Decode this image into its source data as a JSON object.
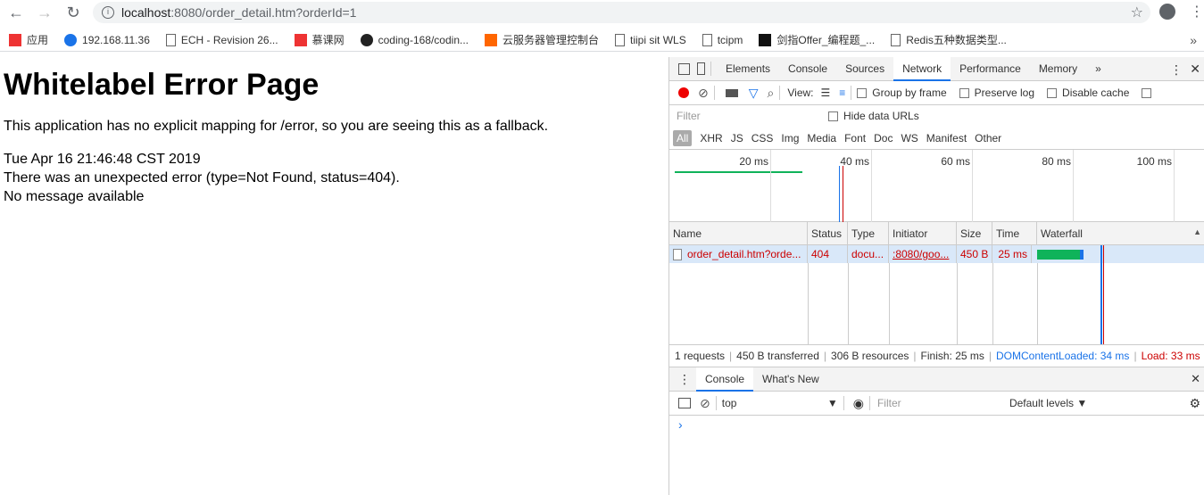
{
  "browser": {
    "url_host": "localhost",
    "url_rest": ":8080/order_detail.htm?orderId=1",
    "bookmarks": [
      {
        "label": "应用",
        "icon": "apps-grid-icon"
      },
      {
        "label": "192.168.11.36",
        "icon": "globe-icon"
      },
      {
        "label": "ECH - Revision 26...",
        "icon": "page-icon"
      },
      {
        "label": "慕课网",
        "icon": "flame-icon"
      },
      {
        "label": "coding-168/codin...",
        "icon": "github-icon"
      },
      {
        "label": "云服务器管理控制台",
        "icon": "aliyun-icon"
      },
      {
        "label": "tiipi sit WLS",
        "icon": "page-icon"
      },
      {
        "label": "tcipm",
        "icon": "page-icon"
      },
      {
        "label": "剑指Offer_编程题_...",
        "icon": "nowcoder-icon"
      },
      {
        "label": "Redis五种数据类型...",
        "icon": "bookmark-icon"
      }
    ],
    "more": "»"
  },
  "page": {
    "title": "Whitelabel Error Page",
    "line1": "This application has no explicit mapping for /error, so you are seeing this as a fallback.",
    "line2": "Tue Apr 16 21:46:48 CST 2019",
    "line3": "There was an unexpected error (type=Not Found, status=404).",
    "line4": "No message available"
  },
  "devtools": {
    "tabs": [
      "Elements",
      "Console",
      "Sources",
      "Network",
      "Performance",
      "Memory"
    ],
    "active_tab": "Network",
    "more": "»",
    "view_label": "View:",
    "group_by_frame": "Group by frame",
    "preserve_log": "Preserve log",
    "disable_cache": "Disable cache",
    "filter_placeholder": "Filter",
    "hide_data_urls": "Hide data URLs",
    "types": [
      "All",
      "XHR",
      "JS",
      "CSS",
      "Img",
      "Media",
      "Font",
      "Doc",
      "WS",
      "Manifest",
      "Other"
    ],
    "ticks": [
      "20 ms",
      "40 ms",
      "60 ms",
      "80 ms",
      "100 ms"
    ],
    "columns": [
      "Name",
      "Status",
      "Type",
      "Initiator",
      "Size",
      "Time",
      "Waterfall"
    ],
    "row": {
      "name": "order_detail.htm?orde...",
      "status": "404",
      "type": "docu...",
      "initiator": ":8080/goo...",
      "size": "450 B",
      "time": "25 ms"
    },
    "summary": {
      "requests": "1 requests",
      "transferred": "450 B transferred",
      "resources": "306 B resources",
      "finish": "Finish: 25 ms",
      "dcl": "DOMContentLoaded: 34 ms",
      "load": "Load: 33 ms"
    },
    "drawer_tabs": [
      "Console",
      "What's New"
    ],
    "context": "top",
    "console_filter": "Filter",
    "levels": "Default levels ▼",
    "prompt": "›",
    "colors": {
      "accent": "#1a73e8",
      "error": "#cc0000",
      "bar": "#0fb35a"
    }
  }
}
